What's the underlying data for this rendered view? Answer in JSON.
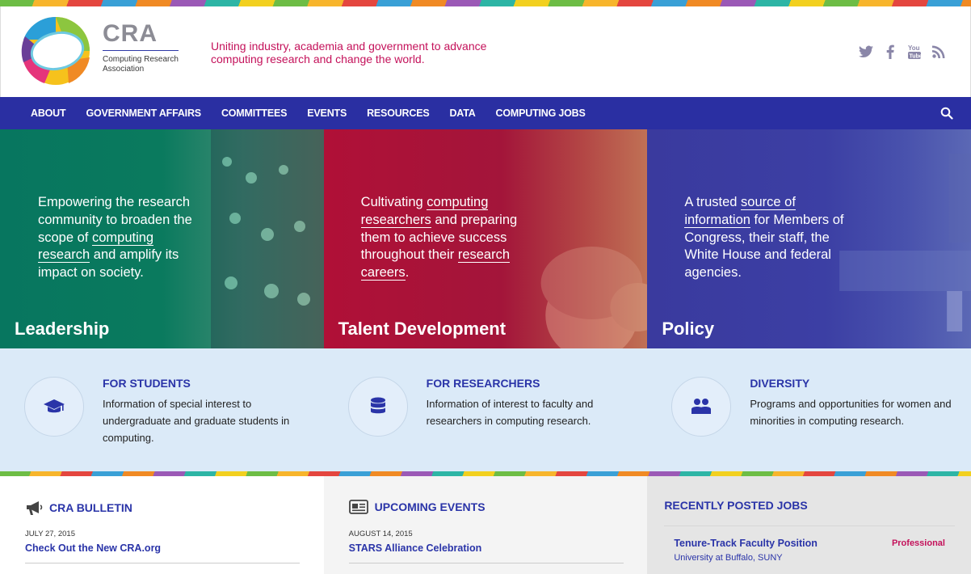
{
  "brand": {
    "abbr": "CRA",
    "full_name": "Computing Research Association",
    "tagline": "Uniting industry, academia and government to advance computing research and change the world."
  },
  "social_icons": [
    "twitter-icon",
    "facebook-icon",
    "youtube-icon",
    "rss-icon"
  ],
  "nav": {
    "items": [
      "ABOUT",
      "GOVERNMENT AFFAIRS",
      "COMMITTEES",
      "EVENTS",
      "RESOURCES",
      "DATA",
      "COMPUTING JOBS"
    ],
    "search_icon": "search-icon"
  },
  "hero": [
    {
      "title": "Leadership",
      "text_pre": "Empowering the research community to broaden the scope of ",
      "link1": "computing research",
      "text_mid": " and amplify its impact on society.",
      "link2": "",
      "text_post": "",
      "color": "#07765f"
    },
    {
      "title": "Talent Development",
      "text_pre": "Cultivating ",
      "link1": "computing researchers",
      "text_mid": " and preparing them to achieve success throughout their ",
      "link2": "research careers",
      "text_post": ".",
      "color": "#b01037"
    },
    {
      "title": "Policy",
      "text_pre": "A trusted ",
      "link1": "source of information",
      "text_mid": " for Members of Congress, their staff, the White House and federal agencies.",
      "link2": "",
      "text_post": "",
      "color": "#3a3a9e"
    }
  ],
  "audiences": [
    {
      "title": "FOR STUDENTS",
      "desc": "Information of special interest to undergraduate and graduate students in computing.",
      "icon": "graduation-cap-icon"
    },
    {
      "title": "FOR RESEARCHERS",
      "desc": "Information of interest to faculty and researchers in computing research.",
      "icon": "database-icon"
    },
    {
      "title": "DIVERSITY",
      "desc": "Programs and opportunities for women and minorities in computing research.",
      "icon": "people-icon"
    }
  ],
  "bulletin": {
    "heading": "CRA BULLETIN",
    "icon": "megaphone-icon",
    "date": "JULY 27, 2015",
    "link": "Check Out the New CRA.org"
  },
  "events": {
    "heading": "UPCOMING EVENTS",
    "icon": "calendar-card-icon",
    "date": "AUGUST 14, 2015",
    "link": "STARS Alliance Celebration"
  },
  "jobs": {
    "heading": "RECENTLY POSTED JOBS",
    "title": "Tenure-Track Faculty Position",
    "org": "University at Buffalo, SUNY",
    "type": "Professional"
  },
  "colors": {
    "nav": "#2a2fa2",
    "accent": "#c4115a",
    "link": "#2a34a8"
  }
}
